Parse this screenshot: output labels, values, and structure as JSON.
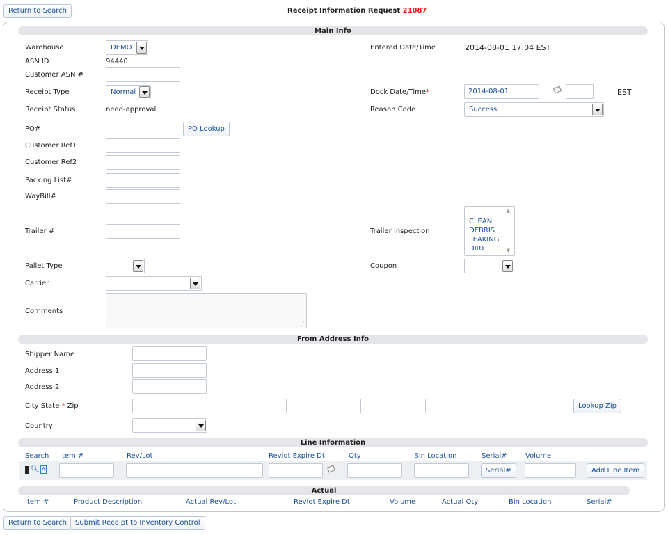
{
  "header": {
    "return_label": "Return to Search",
    "title": "Receipt Information Request",
    "request_id": "21087"
  },
  "main_info": {
    "section_title": "Main Info",
    "warehouse_label": "Warehouse",
    "warehouse_value": "DEMO",
    "asn_id_label": "ASN ID",
    "asn_id_value": "94440",
    "customer_asn_label": "Customer ASN #",
    "customer_asn_value": "",
    "receipt_type_label": "Receipt Type",
    "receipt_type_value": "Normal",
    "receipt_status_label": "Receipt Status",
    "receipt_status_value": "need-approval",
    "po_label": "PO#",
    "po_value": "",
    "po_lookup_label": "PO Lookup",
    "customer_ref1_label": "Customer Ref1",
    "customer_ref2_label": "Customer Ref2",
    "packing_list_label": "Packing List#",
    "waybill_label": "WayBill#",
    "trailer_label": "Trailer #",
    "pallet_type_label": "Pallet Type",
    "pallet_type_value": "",
    "carrier_label": "Carrier",
    "carrier_value": "",
    "comments_label": "Comments",
    "entered_label": "Entered Date/Time",
    "entered_value": "2014-08-01 17:04 EST",
    "dock_label": "Dock Date/Time",
    "dock_required": "*",
    "dock_date_value": "2014-08-01",
    "dock_time_value": "",
    "timezone": "EST",
    "reason_label": "Reason Code",
    "reason_value": "Success",
    "trailer_inspection_label": "Trailer Inspection",
    "trailer_inspection_options": [
      "CLEAN",
      "DEBRIS",
      "LEAKING",
      "DIRT"
    ],
    "coupon_label": "Coupon",
    "coupon_value": ""
  },
  "from_address": {
    "section_title": "From Address Info",
    "shipper_label": "Shipper Name",
    "address1_label": "Address 1",
    "address2_label": "Address 2",
    "city_label": "City State",
    "city_required": "*",
    "zip_label": "Zip",
    "lookup_zip_label": "Lookup Zip",
    "country_label": "Country",
    "country_value": ""
  },
  "line_info": {
    "section_title": "Line Information",
    "columns": [
      "Search",
      "Item #",
      "Rev/Lot",
      "Revlot Expire Dt",
      "Qty",
      "Bin Location",
      "Serial#",
      "Volume"
    ],
    "serial_button_label": "Serial#",
    "add_line_label": "Add Line Item"
  },
  "actual": {
    "section_title": "Actual",
    "columns": [
      "Item #",
      "Product Description",
      "Actual Rev/Lot",
      "Revlot Expire Dt",
      "Volume",
      "Actual Qty",
      "Bin Location",
      "Serial#"
    ]
  },
  "footer": {
    "return_label": "Return to Search",
    "submit_label": "Submit Receipt to Inventory Control"
  },
  "colors": {
    "link_blue": "#1b4f9c",
    "required_red": "#e02020",
    "section_gray": "#e3e5e8"
  }
}
